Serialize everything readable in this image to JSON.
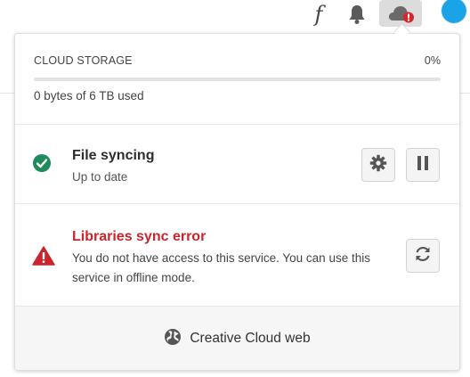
{
  "topbar": {
    "fonts_glyph": "f",
    "icons": [
      "fonts-icon",
      "bell-icon",
      "cloud-error-icon",
      "avatar"
    ],
    "accent": "#1ba3e8"
  },
  "storage": {
    "label": "CLOUD STORAGE",
    "percent_text": "0%",
    "percent_value": 0,
    "used_text": "0 bytes of 6 TB used"
  },
  "file_sync": {
    "title": "File syncing",
    "status": "Up to date",
    "status_color": "#1e8b5a",
    "icons": [
      "check-circle-icon",
      "gear-icon",
      "pause-icon"
    ]
  },
  "libraries": {
    "title": "Libraries sync error",
    "message_line1": "You do not have access to this service. You can use this",
    "message_line2": "service in offline mode.",
    "error_color": "#c9252c",
    "icons": [
      "warning-icon",
      "refresh-icon"
    ]
  },
  "footer": {
    "link_label": "Creative Cloud web",
    "icon": "globe-icon"
  }
}
